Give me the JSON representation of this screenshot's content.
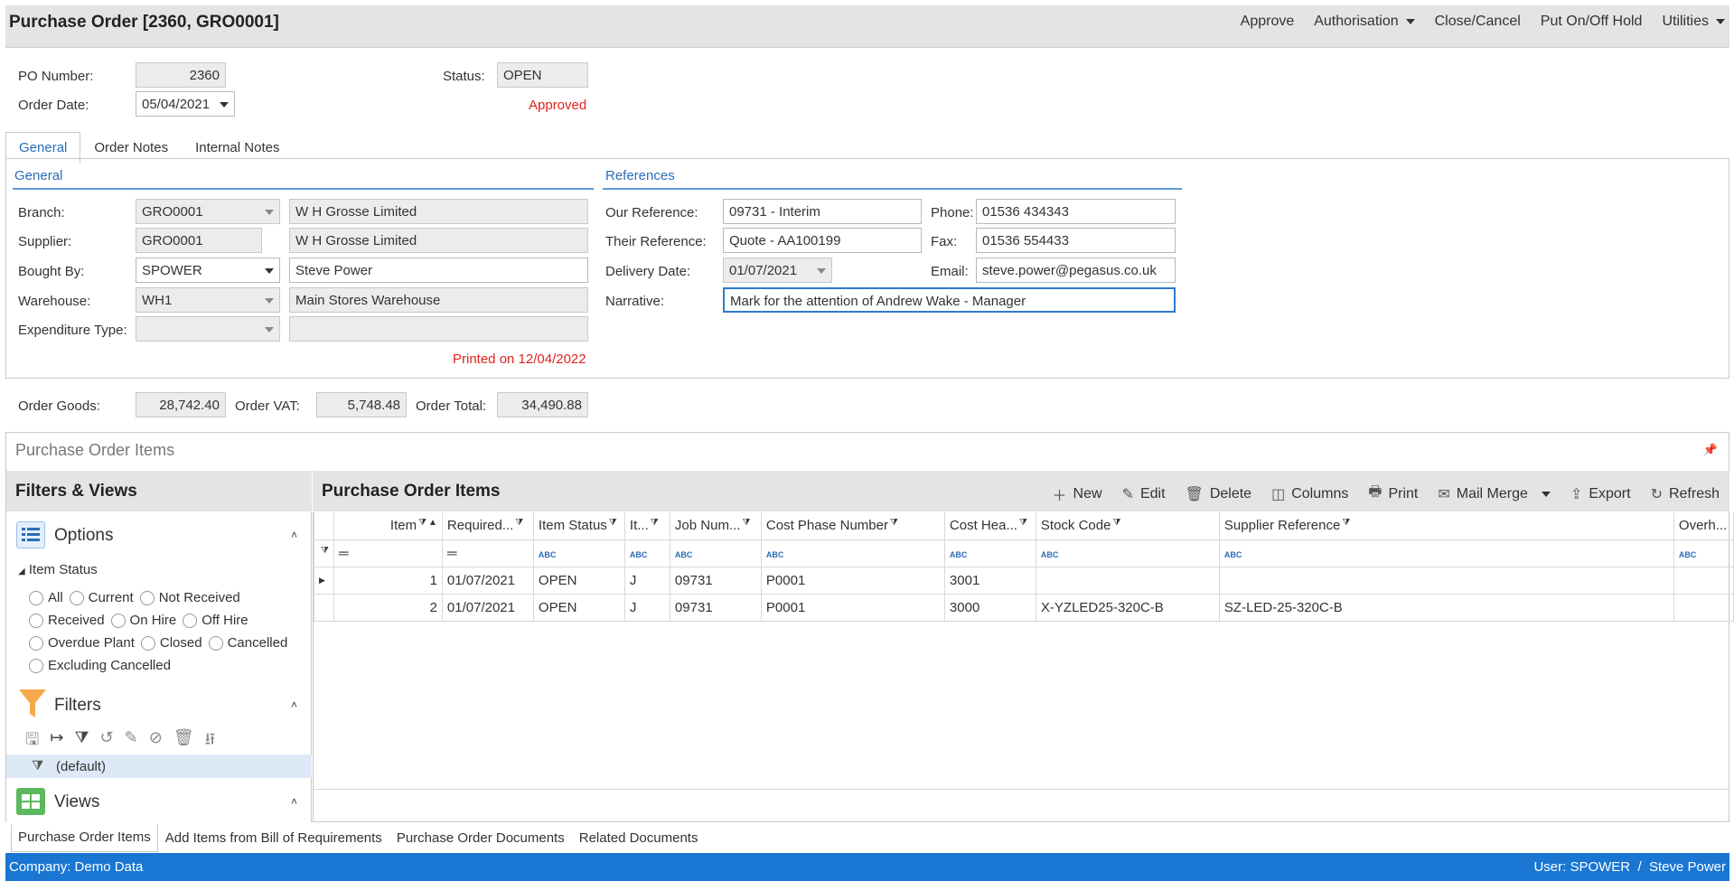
{
  "window": {
    "title": "Purchase Order [2360, GRO0001]",
    "menu": [
      "Approve",
      "Authorisation",
      "Close/Cancel",
      "Put On/Off Hold",
      "Utilities"
    ]
  },
  "header": {
    "po_number_label": "PO Number:",
    "po_number": "2360",
    "order_date_label": "Order Date:",
    "order_date": "05/04/2021",
    "status_label": "Status:",
    "status": "OPEN",
    "approved_text": "Approved"
  },
  "tabs": [
    "General",
    "Order Notes",
    "Internal Notes"
  ],
  "general": {
    "section_title": "General",
    "branch_label": "Branch:",
    "branch_code": "GRO0001",
    "branch_name": "W H Grosse Limited",
    "supplier_label": "Supplier:",
    "supplier_code": "GRO0001",
    "supplier_name": "W H Grosse Limited",
    "bought_by_label": "Bought By:",
    "bought_by_code": "SPOWER",
    "bought_by_name": "Steve Power",
    "warehouse_label": "Warehouse:",
    "warehouse_code": "WH1",
    "warehouse_name": "Main Stores Warehouse",
    "expenditure_label": "Expenditure Type:",
    "expenditure_code": "",
    "expenditure_name": "",
    "printed_text": "Printed on 12/04/2022"
  },
  "references": {
    "section_title": "References",
    "our_ref_label": "Our Reference:",
    "our_ref": "09731 - Interim",
    "their_ref_label": "Their Reference:",
    "their_ref": "Quote - AA100199",
    "delivery_label": "Delivery Date:",
    "delivery_date": "01/07/2021",
    "narrative_label": "Narrative:",
    "narrative": "Mark for the attention of Andrew Wake - Manager",
    "phone_label": "Phone:",
    "phone": "01536 434343",
    "fax_label": "Fax:",
    "fax": "01536 554433",
    "email_label": "Email:",
    "email": "steve.power@pegasus.co.uk"
  },
  "totals": {
    "goods_label": "Order Goods:",
    "goods": "28,742.40",
    "vat_label": "Order VAT:",
    "vat": "5,748.48",
    "total_label": "Order Total:",
    "total": "34,490.88"
  },
  "items_panel": {
    "heading": "Purchase Order Items",
    "filters_title": "Filters & Views",
    "options_title": "Options",
    "item_status_label": "Item Status",
    "status_options": [
      [
        "All",
        "Current",
        "Not Received"
      ],
      [
        "Received",
        "On Hire",
        "Off Hire"
      ],
      [
        "Overdue Plant",
        "Closed",
        "Cancelled"
      ],
      [
        "Excluding Cancelled"
      ]
    ],
    "filters_label": "Filters",
    "default_filter": "(default)",
    "views_label": "Views"
  },
  "grid": {
    "title": "Purchase Order Items",
    "toolbar": [
      "New",
      "Edit",
      "Delete",
      "Columns",
      "Print",
      "Mail Merge",
      "Export",
      "Refresh"
    ],
    "columns": [
      "Item",
      "Required...",
      "Item Status",
      "It...",
      "Job Num...",
      "Cost Phase Number",
      "Cost Hea...",
      "Stock Code",
      "Supplier Reference",
      "Overh..."
    ],
    "rows": [
      [
        "1",
        "01/07/2021",
        "OPEN",
        "J",
        "09731",
        "P0001",
        "3001",
        "",
        "",
        ""
      ],
      [
        "2",
        "01/07/2021",
        "OPEN",
        "J",
        "09731",
        "P0001",
        "3000",
        "X-YZLED25-320C-B",
        "SZ-LED-25-320C-B",
        ""
      ]
    ]
  },
  "bottom_tabs": [
    "Purchase Order Items",
    "Add Items from Bill of Requirements",
    "Purchase Order Documents",
    "Related Documents"
  ],
  "statusbar": {
    "company": "Company: Demo Data",
    "user": "User: SPOWER  /  Steve Power"
  },
  "colors": {
    "accent": "#1976d2",
    "section_blue": "#2a6db5",
    "error_red": "#e0231d"
  }
}
